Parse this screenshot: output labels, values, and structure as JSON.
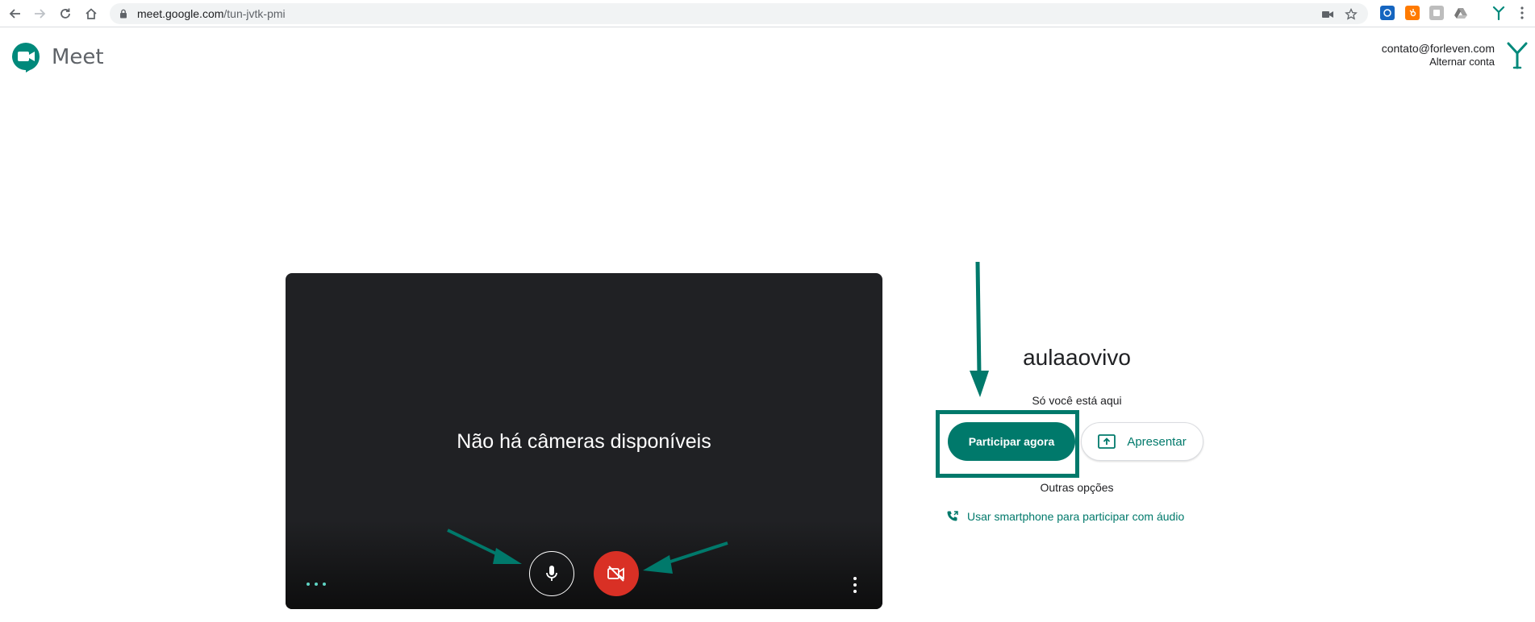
{
  "browser": {
    "url_domain": "meet.google.com",
    "url_path": "/tun-jvtk-pmi"
  },
  "app": {
    "name": "Meet",
    "brand_color": "#00796b"
  },
  "account": {
    "email": "contato@forleven.com",
    "switch_label": "Alternar conta"
  },
  "preview": {
    "no_camera_text": "Não há câmeras disponíveis",
    "mic_icon": "microphone-icon",
    "camera_icon": "camera-off-icon",
    "camera_off_color": "#d93025"
  },
  "join_panel": {
    "meeting_name": "aulaaovivo",
    "participants_status": "Só você está aqui",
    "join_button": "Participar agora",
    "present_button": "Apresentar",
    "other_options": "Outras opções",
    "phone_option": "Usar smartphone para participar com áudio"
  }
}
